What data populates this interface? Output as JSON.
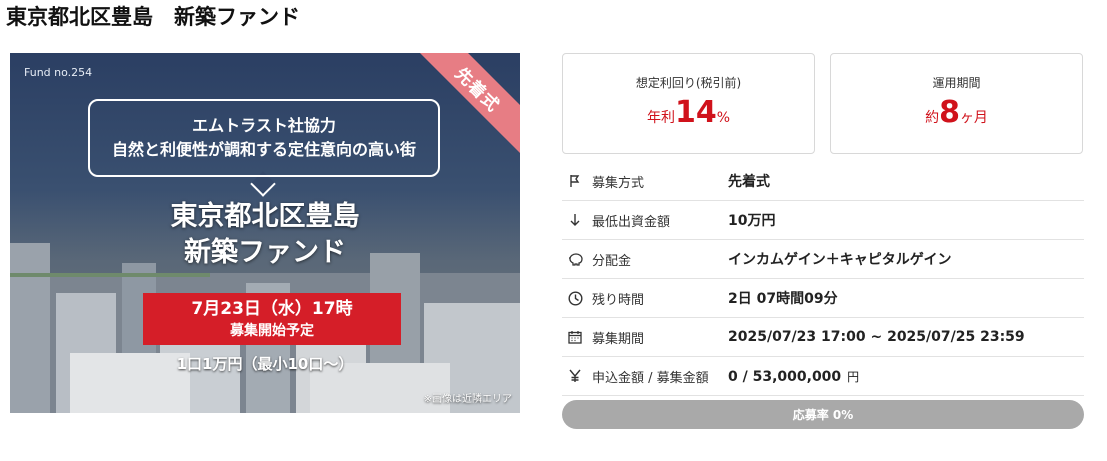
{
  "page": {
    "title": "東京都北区豊島　新築ファンド"
  },
  "hero": {
    "fund_no": "Fund no.254",
    "ribbon": "先着式",
    "bubble_line1": "エムトラスト社協力",
    "bubble_line2": "自然と利便性が調和する定住意向の高い街",
    "headline_line1": "東京都北区豊島",
    "headline_line2": "新築ファンド",
    "start_line1": "7月23日（水）17時",
    "start_line2": "募集開始予定",
    "units": "1口1万円（最小10口〜）",
    "note": "※画像は近隣エリア"
  },
  "cards": {
    "yield": {
      "label": "想定利回り(税引前)",
      "prefix": "年利",
      "value": "14",
      "suffix": "%"
    },
    "period": {
      "label": "運用期間",
      "prefix": "約",
      "value": "8",
      "suffix": "ヶ月"
    }
  },
  "details": [
    {
      "icon": "flag-icon",
      "label": "募集方式",
      "value": "先着式"
    },
    {
      "icon": "arrow-down-icon",
      "label": "最低出資金額",
      "value": "10万円"
    },
    {
      "icon": "piggy-bank-icon",
      "label": "分配金",
      "value": "インカムゲイン＋キャピタルゲイン"
    },
    {
      "icon": "clock-icon",
      "label": "残り時間",
      "value": "2日 07時間09分"
    },
    {
      "icon": "calendar-icon",
      "label": "募集期間",
      "value": "2025/07/23 17:00 ~ 2025/07/25 23:59"
    },
    {
      "icon": "yen-icon",
      "label": "申込金額 / 募集金額",
      "value": "0 / 53,000,000",
      "unit": "円"
    }
  ],
  "progress": {
    "label": "応募率 0%",
    "percent": 0
  },
  "colors": {
    "accent": "#d0121b",
    "ribbon": "#e77d84",
    "progress_bg": "#a9a9a9"
  }
}
